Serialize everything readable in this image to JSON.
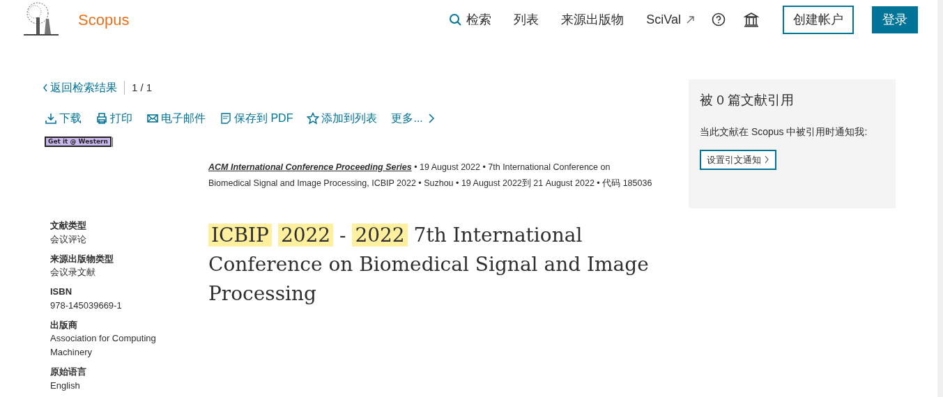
{
  "header": {
    "brand": "Scopus",
    "nav": [
      "检索",
      "列表",
      "来源出版物",
      "SciVal"
    ],
    "create_account": "创建帐户",
    "login": "登录"
  },
  "back": {
    "label": "返回检索结果",
    "position": "1 / 1"
  },
  "actions": [
    "下载",
    "打印",
    "电子邮件",
    "保存到 PDF",
    "添加到列表",
    "更多..."
  ],
  "get_it": "Get it @ Western",
  "source": {
    "series": "ACM International Conference Proceeding Series",
    "separator": "•",
    "items": [
      "19 August 2022",
      "7th International Conference on Biomedical Signal and Image Processing, ICBIP 2022",
      "Suzhou",
      "19 August 2022到 21 August 2022",
      "代码 185036"
    ]
  },
  "title": [
    {
      "text": "ICBIP",
      "highlighted": true
    },
    {
      "text": "2022",
      "highlighted": true
    },
    {
      "text": "-",
      "highlighted": false
    },
    {
      "text": "2022",
      "highlighted": true
    },
    {
      "text": "7th International Conference on Biomedical Signal and Image Processing",
      "highlighted": false
    }
  ],
  "details": [
    {
      "label": "文献类型",
      "value": "会议评论"
    },
    {
      "label": "来源出版物类型",
      "value": "会议录文献"
    },
    {
      "label": "ISBN",
      "value": "978-145039669-1"
    },
    {
      "label": "出版商",
      "value": "Association for Computing Machinery"
    },
    {
      "label": "原始语言",
      "value": "English"
    }
  ],
  "citations": {
    "heading": "被 0 篇文献引用",
    "notice": "当此文献在 Scopus 中被引用时通知我:",
    "button": "设置引文通知"
  }
}
